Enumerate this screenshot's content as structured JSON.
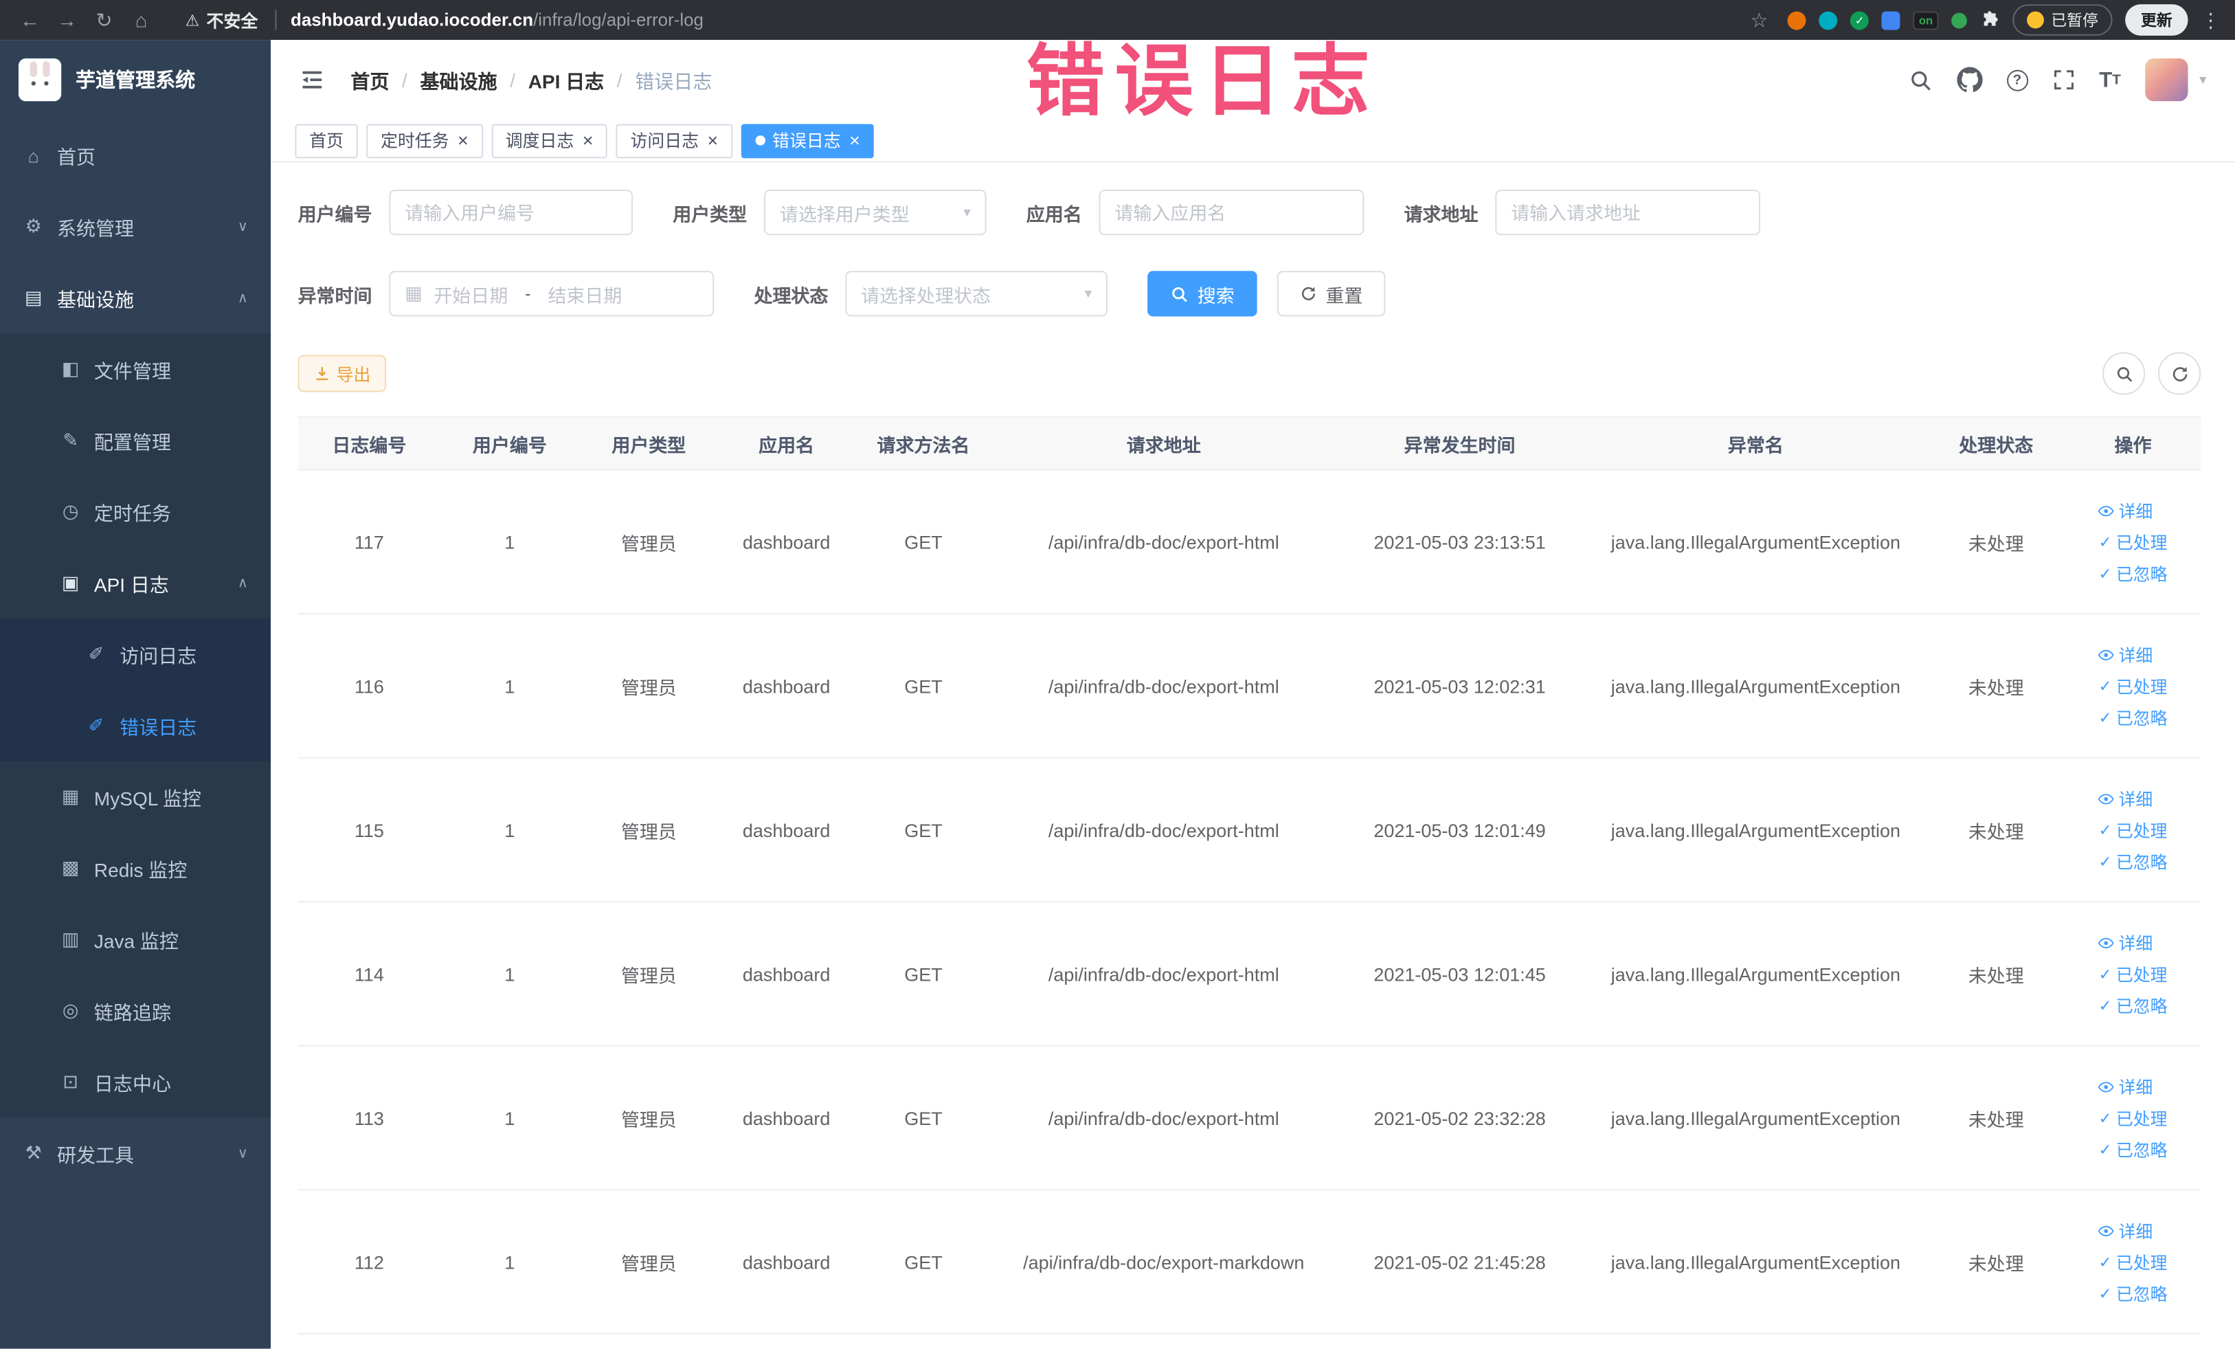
{
  "annotation": {
    "text": "错误日志",
    "color": "#f1517a"
  },
  "browser": {
    "security_label": "不安全",
    "url_domain": "dashboard.yudao.iocoder.cn",
    "url_path": "/infra/log/api-error-log",
    "extension_badge": "on",
    "paused_label": "已暂停",
    "update_label": "更新"
  },
  "sidebar": {
    "title": "芋道管理系统",
    "items": [
      {
        "key": "home",
        "label": "首页",
        "icon": "home",
        "level": 0
      },
      {
        "key": "system-mgmt",
        "label": "系统管理",
        "icon": "gear",
        "level": 0,
        "chevron": "down"
      },
      {
        "key": "infrastructure",
        "label": "基础设施",
        "icon": "infra",
        "level": 0,
        "chevron": "up",
        "open": true
      },
      {
        "key": "file-mgmt",
        "label": "文件管理",
        "icon": "file",
        "level": 1
      },
      {
        "key": "config-mgmt",
        "label": "配置管理",
        "icon": "edit",
        "level": 1
      },
      {
        "key": "scheduled-tasks",
        "label": "定时任务",
        "icon": "timer",
        "level": 1
      },
      {
        "key": "api-log",
        "label": "API 日志",
        "icon": "apilog",
        "level": 1,
        "chevron": "up",
        "open": true
      },
      {
        "key": "access-log",
        "label": "访问日志",
        "icon": "doc",
        "level": 2
      },
      {
        "key": "error-log",
        "label": "错误日志",
        "icon": "doc",
        "level": 2,
        "active": true
      },
      {
        "key": "mysql-monitor",
        "label": "MySQL 监控",
        "icon": "monitor",
        "level": 1
      },
      {
        "key": "redis-monitor",
        "label": "Redis 监控",
        "icon": "redis",
        "level": 1
      },
      {
        "key": "java-monitor",
        "label": "Java 监控",
        "icon": "java",
        "level": 1
      },
      {
        "key": "link-tracing",
        "label": "链路追踪",
        "icon": "trace",
        "level": 1
      },
      {
        "key": "log-center",
        "label": "日志中心",
        "icon": "logcenter",
        "level": 1
      },
      {
        "key": "dev-tools",
        "label": "研发工具",
        "icon": "tools",
        "level": 0,
        "chevron": "down"
      }
    ]
  },
  "header": {
    "breadcrumb": [
      "首页",
      "基础设施",
      "API 日志",
      "错误日志"
    ]
  },
  "tabs": [
    {
      "key": "home",
      "label": "首页",
      "closable": false,
      "active": false
    },
    {
      "key": "job",
      "label": "定时任务",
      "closable": true,
      "active": false
    },
    {
      "key": "job-log",
      "label": "调度日志",
      "closable": true,
      "active": false
    },
    {
      "key": "access-log",
      "label": "访问日志",
      "closable": true,
      "active": false
    },
    {
      "key": "error-log",
      "label": "错误日志",
      "closable": true,
      "active": true
    }
  ],
  "filters": {
    "user_id": {
      "label": "用户编号",
      "placeholder": "请输入用户编号"
    },
    "user_type": {
      "label": "用户类型",
      "placeholder": "请选择用户类型"
    },
    "app_name": {
      "label": "应用名",
      "placeholder": "请输入应用名"
    },
    "request_url": {
      "label": "请求地址",
      "placeholder": "请输入请求地址"
    },
    "exception_time": {
      "label": "异常时间",
      "start_placeholder": "开始日期",
      "separator": "-",
      "end_placeholder": "结束日期"
    },
    "process_status": {
      "label": "处理状态",
      "placeholder": "请选择处理状态"
    },
    "search_label": "搜索",
    "reset_label": "重置"
  },
  "toolbar": {
    "export_label": "导出"
  },
  "table": {
    "columns": [
      "日志编号",
      "用户编号",
      "用户类型",
      "应用名",
      "请求方法名",
      "请求地址",
      "异常发生时间",
      "异常名",
      "处理状态",
      "操作"
    ],
    "rows": [
      {
        "id": "117",
        "user_id": "1",
        "user_type": "管理员",
        "app": "dashboard",
        "method": "GET",
        "url": "/api/infra/db-doc/export-html",
        "time": "2021-05-03 23:13:51",
        "exception": "java.lang.IllegalArgumentException",
        "status": "未处理"
      },
      {
        "id": "116",
        "user_id": "1",
        "user_type": "管理员",
        "app": "dashboard",
        "method": "GET",
        "url": "/api/infra/db-doc/export-html",
        "time": "2021-05-03 12:02:31",
        "exception": "java.lang.IllegalArgumentException",
        "status": "未处理"
      },
      {
        "id": "115",
        "user_id": "1",
        "user_type": "管理员",
        "app": "dashboard",
        "method": "GET",
        "url": "/api/infra/db-doc/export-html",
        "time": "2021-05-03 12:01:49",
        "exception": "java.lang.IllegalArgumentException",
        "status": "未处理"
      },
      {
        "id": "114",
        "user_id": "1",
        "user_type": "管理员",
        "app": "dashboard",
        "method": "GET",
        "url": "/api/infra/db-doc/export-html",
        "time": "2021-05-03 12:01:45",
        "exception": "java.lang.IllegalArgumentException",
        "status": "未处理"
      },
      {
        "id": "113",
        "user_id": "1",
        "user_type": "管理员",
        "app": "dashboard",
        "method": "GET",
        "url": "/api/infra/db-doc/export-html",
        "time": "2021-05-02 23:32:28",
        "exception": "java.lang.IllegalArgumentException",
        "status": "未处理"
      },
      {
        "id": "112",
        "user_id": "1",
        "user_type": "管理员",
        "app": "dashboard",
        "method": "GET",
        "url": "/api/infra/db-doc/export-markdown",
        "time": "2021-05-02 21:45:28",
        "exception": "java.lang.IllegalArgumentException",
        "status": "未处理"
      }
    ],
    "actions": {
      "detail": "详细",
      "processed": "已处理",
      "ignored": "已忽略"
    }
  },
  "colors": {
    "primary": "#409eff",
    "warning": "#e6a23c",
    "sidebar_bg": "#304156",
    "chrome_bg": "#2e3035"
  }
}
